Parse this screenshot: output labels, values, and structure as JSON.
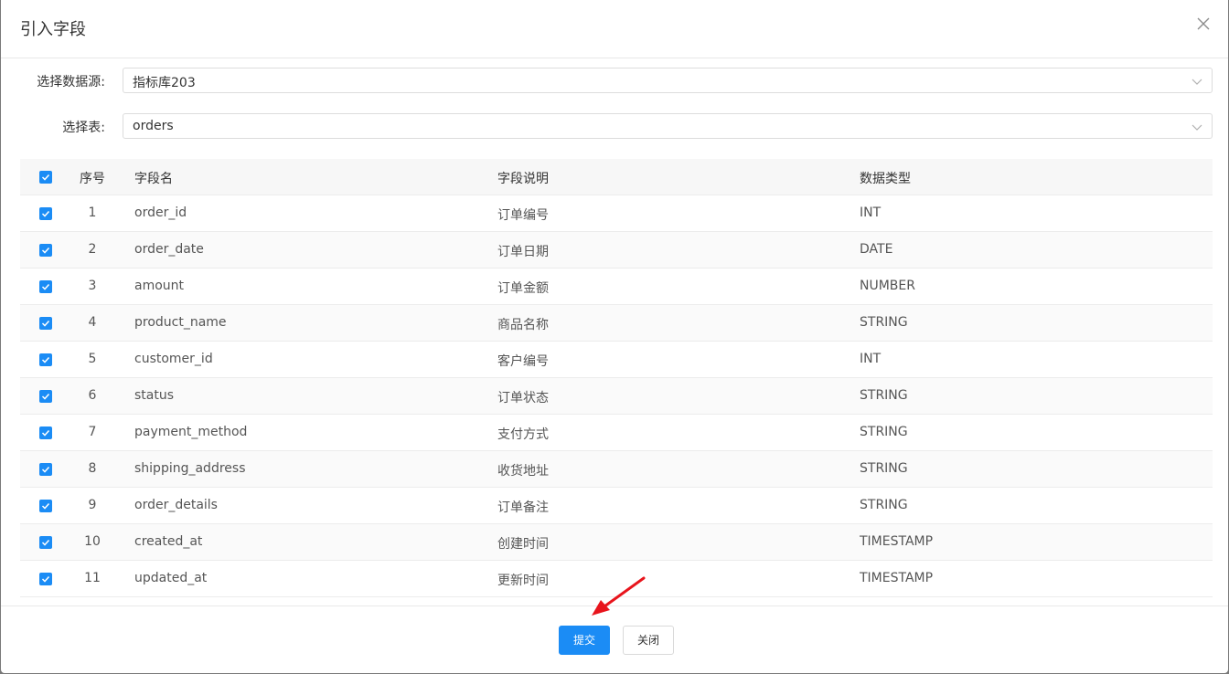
{
  "dialog": {
    "title": "引入字段"
  },
  "form": {
    "datasource_label": "选择数据源:",
    "datasource_value": "指标库203",
    "table_label": "选择表:",
    "table_value": "orders"
  },
  "table": {
    "headers": {
      "index": "序号",
      "name": "字段名",
      "desc": "字段说明",
      "type": "数据类型"
    },
    "rows": [
      {
        "index": "1",
        "name": "order_id",
        "desc": "订单编号",
        "type": "INT"
      },
      {
        "index": "2",
        "name": "order_date",
        "desc": "订单日期",
        "type": "DATE"
      },
      {
        "index": "3",
        "name": "amount",
        "desc": "订单金额",
        "type": "NUMBER"
      },
      {
        "index": "4",
        "name": "product_name",
        "desc": "商品名称",
        "type": "STRING"
      },
      {
        "index": "5",
        "name": "customer_id",
        "desc": "客户编号",
        "type": "INT"
      },
      {
        "index": "6",
        "name": "status",
        "desc": "订单状态",
        "type": "STRING"
      },
      {
        "index": "7",
        "name": "payment_method",
        "desc": "支付方式",
        "type": "STRING"
      },
      {
        "index": "8",
        "name": "shipping_address",
        "desc": "收货地址",
        "type": "STRING"
      },
      {
        "index": "9",
        "name": "order_details",
        "desc": "订单备注",
        "type": "STRING"
      },
      {
        "index": "10",
        "name": "created_at",
        "desc": "创建时间",
        "type": "TIMESTAMP"
      },
      {
        "index": "11",
        "name": "updated_at",
        "desc": "更新时间",
        "type": "TIMESTAMP"
      }
    ]
  },
  "footer": {
    "submit_label": "提交",
    "close_label": "关闭"
  },
  "colors": {
    "primary": "#1b8cf5",
    "annotation_arrow": "#e8141c"
  },
  "icons": {
    "close": "close-icon",
    "dropdown": "chevron-down-icon",
    "checkbox": "checkmark-icon",
    "annotation": "red-arrow-annotation"
  }
}
